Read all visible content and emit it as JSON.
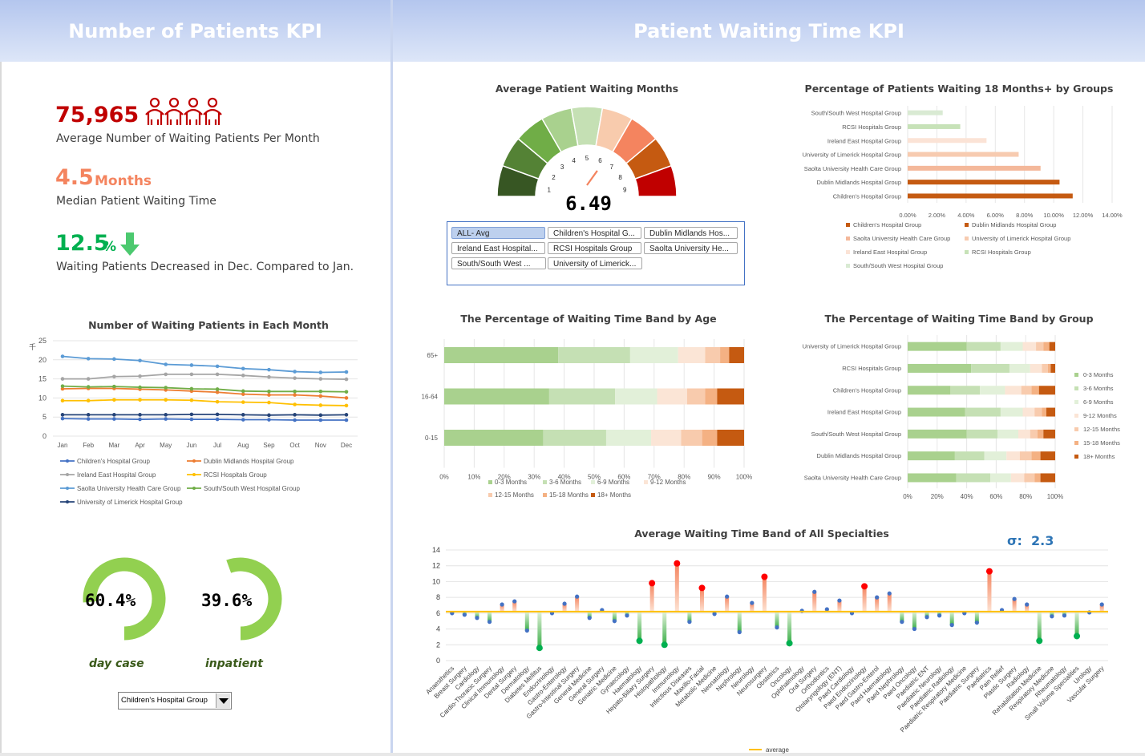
{
  "headers": {
    "left": "Number of Patients KPI",
    "right": "Patient Waiting Time KPI"
  },
  "kpi": {
    "patients_value": "75,965",
    "patients_label": "Average Number of Waiting Patients Per Month",
    "median_value": "4.5",
    "median_unit": "Months",
    "median_label": "Median Patient Waiting Time",
    "decrease_value": "12.5",
    "decrease_unit": "%",
    "decrease_label": "Waiting Patients Decreased in Dec. Compared to Jan."
  },
  "colors": {
    "red": "#c00000",
    "orange": "#f4845f",
    "green": "#00b050",
    "ring": "#92d050"
  },
  "icons": {
    "people": "people-icon",
    "down_arrow": "down-arrow-icon",
    "dropdown": "chevron-down-icon"
  },
  "rings": [
    {
      "pct": "60.4%",
      "label": "day case",
      "value": 0.604
    },
    {
      "pct": "39.6%",
      "label": "inpatient",
      "value": 0.396
    }
  ],
  "dropdown": {
    "selected": "Children's Hospital Group"
  },
  "gauge": {
    "title": "Average Patient Waiting Months",
    "value": "6.49",
    "ticks": [
      "1",
      "2",
      "3",
      "4",
      "5",
      "6",
      "7",
      "8",
      "9"
    ],
    "needle": 6.49
  },
  "slicer": {
    "items": [
      "ALL- Avg",
      "Children's Hospital G...",
      "Dublin Midlands Hos...",
      "Ireland East Hospital...",
      "RCSI  Hospitals Group",
      "Saolta University He...",
      "South/South West ...",
      "University of Limerick..."
    ],
    "selected": 0
  },
  "sigma": {
    "symbol": "σ:",
    "value": "2.3"
  },
  "chart_data": [
    {
      "type": "line",
      "title": "Number of Waiting Patients in Each Month",
      "ylabel": "千",
      "ylim": [
        0,
        25
      ],
      "yticks": [
        "0",
        "5",
        "10",
        "15",
        "20",
        "25"
      ],
      "x": [
        "Jan",
        "Feb",
        "Mar",
        "Apr",
        "May",
        "Jun",
        "Jul",
        "Aug",
        "Sep",
        "Oct",
        "Nov",
        "Dec"
      ],
      "series": [
        {
          "name": "Children's Hospital Group",
          "color": "#4472c4",
          "values": [
            4.6,
            4.5,
            4.5,
            4.4,
            4.5,
            4.4,
            4.4,
            4.3,
            4.3,
            4.2,
            4.2,
            4.2
          ]
        },
        {
          "name": "Dublin Midlands Hospital Group",
          "color": "#ed7d31",
          "values": [
            12.4,
            12.5,
            12.5,
            12.3,
            12.1,
            11.8,
            11.5,
            11.0,
            10.8,
            10.8,
            10.5,
            10.0
          ]
        },
        {
          "name": "Ireland East Hospital Group",
          "color": "#a5a5a5",
          "values": [
            15.0,
            15.0,
            15.6,
            15.7,
            16.2,
            16.2,
            16.2,
            15.9,
            15.5,
            15.2,
            15.0,
            14.9
          ]
        },
        {
          "name": "RCSI  Hospitals Group",
          "color": "#ffc000",
          "values": [
            9.3,
            9.3,
            9.5,
            9.5,
            9.5,
            9.4,
            9.0,
            8.9,
            8.8,
            8.3,
            8.1,
            8.0
          ]
        },
        {
          "name": "Saolta University Health Care Group",
          "color": "#5b9bd5",
          "values": [
            20.9,
            20.3,
            20.2,
            19.8,
            18.8,
            18.6,
            18.3,
            17.7,
            17.4,
            16.9,
            16.7,
            16.8
          ]
        },
        {
          "name": "South/South West Hospital Group",
          "color": "#70ad47",
          "values": [
            13.1,
            12.9,
            13.0,
            12.8,
            12.7,
            12.4,
            12.3,
            11.8,
            11.7,
            11.7,
            11.7,
            11.6
          ]
        },
        {
          "name": "University of Limerick Hospital Group",
          "color": "#264478",
          "values": [
            5.6,
            5.6,
            5.6,
            5.6,
            5.6,
            5.7,
            5.7,
            5.6,
            5.5,
            5.6,
            5.5,
            5.6
          ]
        }
      ]
    },
    {
      "type": "bar",
      "title": "Percentage of Patients Waiting 18 Months+ by Groups",
      "categories": [
        "South/South West Hospital Group",
        "RCSI  Hospitals Group",
        "Ireland East Hospital Group",
        "University of Limerick Hospital Group",
        "Saolta University Health Care Group",
        "Dublin Midlands Hospital Group",
        "Children's Hospital Group"
      ],
      "values": [
        2.4,
        3.6,
        5.4,
        7.6,
        9.1,
        10.4,
        11.3
      ],
      "colors": [
        "#d9ead3",
        "#c7e2b8",
        "#fbe3d6",
        "#f7cbb0",
        "#f4b89a",
        "#c55a11",
        "#c55a11"
      ],
      "xticks": [
        "0.00%",
        "2.00%",
        "4.00%",
        "6.00%",
        "8.00%",
        "10.00%",
        "12.00%",
        "14.00%"
      ],
      "xlim": [
        0,
        14
      ],
      "legend": [
        "Children's Hospital Group",
        "Dublin Midlands Hospital Group",
        "Saolta University Health Care Group",
        "University of Limerick Hospital Group",
        "Ireland East Hospital Group",
        "RCSI  Hospitals Group",
        "South/South West Hospital Group"
      ],
      "legend_colors": [
        "#c55a11",
        "#c55a11",
        "#f4b89a",
        "#f7cbb0",
        "#fbe3d6",
        "#c7e2b8",
        "#d9ead3"
      ]
    },
    {
      "type": "bar",
      "title": "The Percentage of Waiting Time Band by Age",
      "categories": [
        "65+",
        "16-64",
        "0-15"
      ],
      "bands": [
        "0-3 Months",
        "3-6 Months",
        "6-9 Months",
        "9-12 Months",
        "12-15 Months",
        "15-18 Months",
        "18+ Months"
      ],
      "band_colors": [
        "#a9d18e",
        "#c5e0b4",
        "#e2f0d9",
        "#fbe5d6",
        "#f8cbad",
        "#f4b183",
        "#c55a11"
      ],
      "values": [
        [
          38,
          24,
          16,
          9,
          5,
          3,
          5
        ],
        [
          35,
          22,
          14,
          10,
          6,
          4,
          9
        ],
        [
          33,
          21,
          15,
          10,
          7,
          5,
          9
        ]
      ],
      "xticks": [
        "0%",
        "10%",
        "20%",
        "30%",
        "40%",
        "50%",
        "60%",
        "70%",
        "80%",
        "90%",
        "100%"
      ]
    },
    {
      "type": "bar",
      "title": "The Percentage of Waiting Time Band by Group",
      "categories": [
        "University of Limerick Hospital Group",
        "RCSI  Hospitals Group",
        "Children's Hospital Group",
        "Ireland East Hospital Group",
        "South/South West Hospital Group",
        "Dublin Midlands Hospital Group",
        "Saolta University Health Care Group"
      ],
      "bands": [
        "0-3 Months",
        "3-6 Months",
        "6-9 Months",
        "9-12 Months",
        "12-15 Months",
        "15-18 Months",
        "18+ Months"
      ],
      "band_colors": [
        "#a9d18e",
        "#c5e0b4",
        "#e2f0d9",
        "#fbe5d6",
        "#f8cbad",
        "#f4b183",
        "#c55a11"
      ],
      "values": [
        [
          40,
          23,
          15,
          9,
          5,
          4,
          4
        ],
        [
          43,
          26,
          14,
          8,
          4,
          2,
          3
        ],
        [
          29,
          20,
          17,
          11,
          7,
          5,
          11
        ],
        [
          39,
          24,
          15,
          8,
          5,
          3,
          6
        ],
        [
          40,
          21,
          14,
          8,
          5,
          4,
          8
        ],
        [
          32,
          20,
          15,
          9,
          8,
          6,
          10
        ],
        [
          33,
          23,
          14,
          9,
          7,
          4,
          10
        ]
      ],
      "legend": [
        "0-3 Months",
        "3-6 Months",
        "6-9 Months",
        "9-12 Months",
        "12-15 Months",
        "15-18 Months",
        "18+ Months"
      ],
      "xticks": [
        "0%",
        "20%",
        "40%",
        "60%",
        "80%",
        "100%"
      ]
    },
    {
      "type": "scatter",
      "title": "Average Waiting Time Band of All Specialties",
      "ylim": [
        0,
        14
      ],
      "yticks": [
        "0",
        "2",
        "4",
        "6",
        "8",
        "10",
        "12",
        "14"
      ],
      "average": 6.2,
      "average_label": "average",
      "categories": [
        "Anaesthetics",
        "Breast Surgery",
        "Cardiology",
        "Cardio-Thoracic Surgery",
        "Clinical Immunology",
        "Dental Surgery",
        "Dermatology",
        "Diabetes Mellitus",
        "Endocrinology",
        "Gastro-Enterology",
        "Gastro-Intestinal Surgery",
        "General Medicine",
        "General Surgery",
        "Geriatric Medicine",
        "Gynaecology",
        "Haematology",
        "Hepato-Biliary Surgery",
        "Histopathology",
        "Immunology",
        "Infectious Diseases",
        "Maxillo-Facial",
        "Metabolic Medicine",
        "Neonatology",
        "Nephrology",
        "Neurology",
        "Neurosurgery",
        "Obstetrics",
        "Oncology",
        "Ophthalmology",
        "Oral Surgery",
        "Orthodontics",
        "Otolaryngology (ENT)",
        "Paed Cardiology",
        "Paed Endocrinology",
        "Paed Gastro-Enterol",
        "Paed Haematology",
        "Paed Nephrology",
        "Paed Oncology",
        "Paediatric ENT",
        "Paediatric Neurology",
        "Paediatric Radiology",
        "Paediatric Respiratory Medicine",
        "Paediatric Surgery",
        "Paediatrics",
        "Pain Relief",
        "Plastic Surgery",
        "Radiology",
        "Rehabilitation Medicine",
        "Respiratory Medicine",
        "Rheumatology",
        "Small Volume Specialities",
        "Urology",
        "Vascular Surgery"
      ],
      "values": [
        6.0,
        5.8,
        5.4,
        4.9,
        7.1,
        7.5,
        3.8,
        1.6,
        6.0,
        7.2,
        8.1,
        5.4,
        6.4,
        5.0,
        5.7,
        2.5,
        9.8,
        2.0,
        12.3,
        4.9,
        9.2,
        5.9,
        8.1,
        3.6,
        7.3,
        10.6,
        4.2,
        2.2,
        6.3,
        8.7,
        6.5,
        7.6,
        6.0,
        9.4,
        8.0,
        8.5,
        4.9,
        4.0,
        5.5,
        5.7,
        4.5,
        6.0,
        4.8,
        11.3,
        6.4,
        7.8,
        7.1,
        2.5,
        5.6,
        5.7,
        3.1,
        6.1,
        7.1
      ]
    }
  ]
}
